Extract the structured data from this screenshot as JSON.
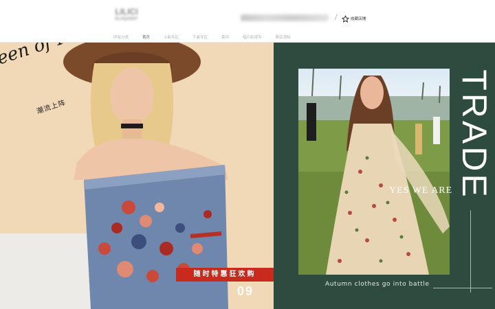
{
  "header": {
    "logo_text": "LILICI",
    "logo_subtext": "ELOQUENT",
    "separator": "/",
    "favorite_label": "收藏店铺"
  },
  "nav": {
    "items": [
      {
        "label": "所有分类"
      },
      {
        "label": "首页"
      },
      {
        "label": "上新专区"
      },
      {
        "label": "下装专区"
      },
      {
        "label": "套件"
      },
      {
        "label": "唱片影视专"
      },
      {
        "label": "购买须知"
      }
    ]
  },
  "banner_left": {
    "script_text": "een of Re grace",
    "tag_text": "潮流上阵",
    "promo_text": "随时特惠狂欢购",
    "number": "09",
    "colors": {
      "background": "#f1d8b6",
      "red": "#c92a1e"
    }
  },
  "banner_right": {
    "vertical_title": "TRADE",
    "overlay_text": "YES WE ARE",
    "caption": "Autumn clothes go into battle",
    "colors": {
      "background": "#2d4c3f"
    }
  },
  "icons": {
    "favorite": "star-outline-icon"
  }
}
